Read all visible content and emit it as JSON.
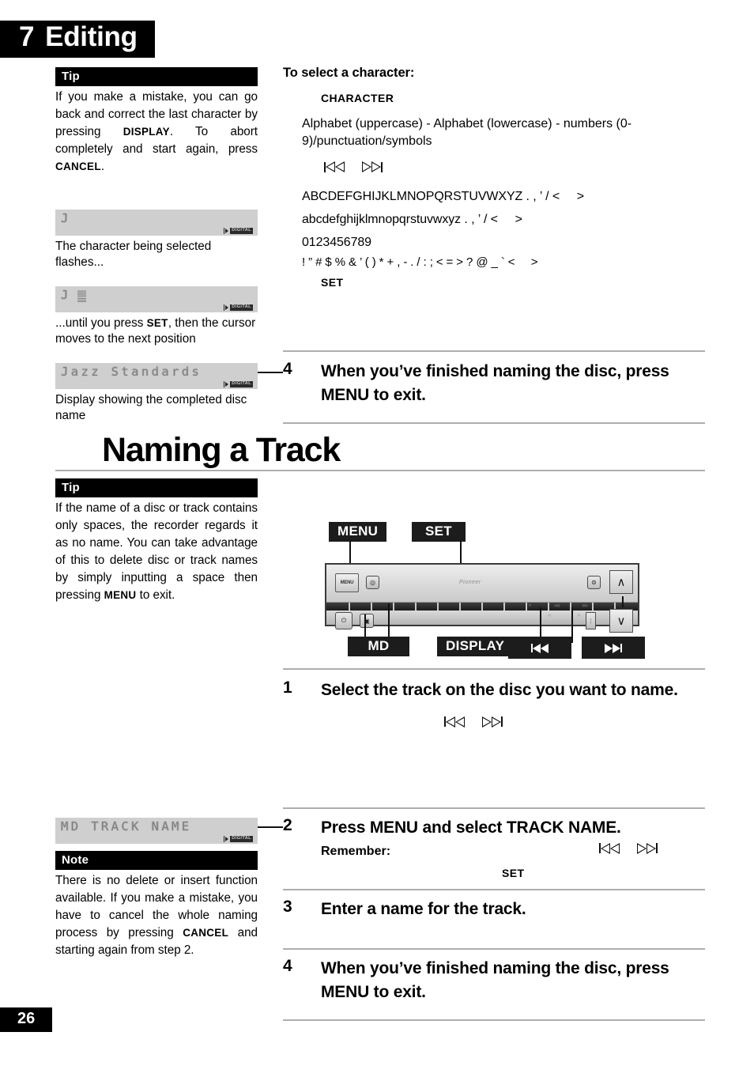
{
  "header": {
    "chapter_number": "7",
    "chapter_title": "Editing"
  },
  "page_number": "26",
  "left_column": {
    "tip1": {
      "heading": "Tip",
      "body_prefix": "If you make a mistake, you can go back and correct the last character by pressing ",
      "body_bold1": "DISPLAY",
      "body_mid": ". To abort completely and start again, press ",
      "body_bold2": "CANCEL",
      "body_suffix": "."
    },
    "display1": {
      "text": "J",
      "indicator": "DIGITAL"
    },
    "caption1": "The character being selected flashes...",
    "display2": {
      "text": "J",
      "indicator": "DIGITAL"
    },
    "caption2_prefix": "...until you press ",
    "caption2_bold": "SET",
    "caption2_suffix": ", then the cursor moves to the next position",
    "display3": {
      "text": "Jazz Standards",
      "indicator": "DIGITAL"
    },
    "caption3": "Display showing the completed disc name",
    "tip2": {
      "heading": "Tip",
      "body_prefix": "If the name of a disc or track contains only spaces, the recorder regards it as no name. You can take advantage of this to delete disc or track names by simply inputting  a space then pressing ",
      "body_bold": "MENU",
      "body_suffix": " to exit."
    },
    "display4": {
      "text": "MD TRACK NAME",
      "indicator": "DIGITAL"
    },
    "note": {
      "heading": "Note",
      "body_prefix": "There is no delete or insert function available. If you make a mistake, you have to cancel the whole naming process by pressing ",
      "body_bold": "CANCEL",
      "body_suffix": " and starting again from step 2."
    }
  },
  "right_column": {
    "char_select": {
      "title": "To select a character:",
      "sub_label": "CHARACTER",
      "description": "Alphabet (uppercase) - Alphabet (lowercase) - numbers (0-9)/punctuation/symbols",
      "charsets": [
        "ABCDEFGHIJKLMNOPQRSTUVWXYZ . , ’ / <     >",
        "abcdefghijklmnopqrstuvwxyz . , ’ / <     >",
        "0123456789",
        "! ” # $ % & ’ ( ) * + , - . / : ; < = > ? @ _ ` <     >"
      ],
      "set_label": "SET"
    },
    "step_disc_4": {
      "num": "4",
      "text": "When you’ve finished naming the disc, press MENU to exit."
    },
    "section_title": "Naming a Track",
    "diagram": {
      "callout_menu": "MENU",
      "callout_set": "SET",
      "callout_md": "MD",
      "callout_display": "DISPLAY",
      "callout_skip_back": "⏮",
      "callout_skip_fwd": "⏭",
      "panel_menu_btn": "MENU",
      "brand": "Pioneer"
    },
    "steps": [
      {
        "num": "1",
        "text": "Select the track on the disc you want to name."
      },
      {
        "num": "2",
        "text": "Press MENU and select TRACK NAME.",
        "remember": "Remember:",
        "set_label": "SET"
      },
      {
        "num": "3",
        "text": "Enter a name for the track."
      },
      {
        "num": "4",
        "text": " When you’ve finished naming the disc, press MENU to exit."
      }
    ]
  }
}
